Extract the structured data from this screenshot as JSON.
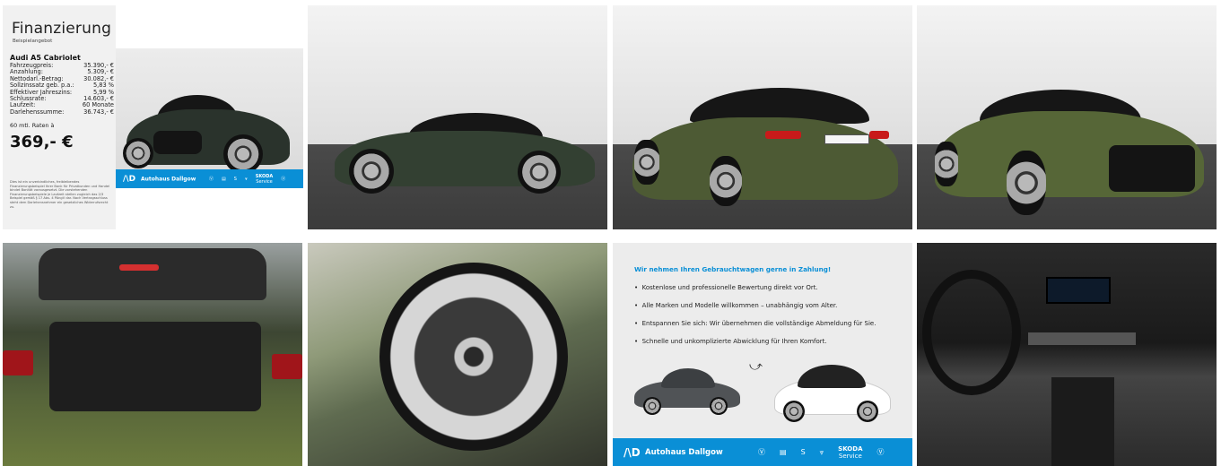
{
  "financing": {
    "title": "Finanzierung",
    "subtitle": "Beispielangebot",
    "model": "Audi A5 Cabriolet",
    "rows": [
      {
        "label": "Fahrzeugpreis:",
        "value": "35.390,- €"
      },
      {
        "label": "Anzahlung:",
        "value": "5.309,- €"
      },
      {
        "label": "Nettodarl.-Betrag:",
        "value": "30.082,- €"
      },
      {
        "label": "Sollzinssatz geb. p.a.:",
        "value": "5,83 %"
      },
      {
        "label": "Effektiver Jahreszins:",
        "value": "5,99 %"
      },
      {
        "label": "Schlussrate:",
        "value": "14.603,- €"
      },
      {
        "label": "Laufzeit:",
        "value": "60 Monate"
      },
      {
        "label": "Darlehenssumme:",
        "value": "36.743,- €"
      }
    ],
    "rate_label": "60 mtl. Raten à",
    "rate_value": "369,- €",
    "footnote": "Dies ist ein unverbindliches, freibleibendes Finanzierungsbeispiel Ihrer Bank für Privatkunden und Handel bindet Bonität vorausgesetzt. Die vorstehenden Finanzierungsbeispiele je Laufzeit stellen zugleich das 2/3 Beispiel gemäß § 17 Abs. 4 PAngV dar. Nach Vertragsschluss steht dem Darlehensnehmer ein gesetzliches Widerrufsrecht zu."
  },
  "dealer": {
    "name": "Autohaus Dallgow",
    "brands": [
      "VW",
      "Nutzfahrzeuge",
      "SEAT",
      "CUPRA",
      "SKODA Service",
      "VW Nutzfahrzeuge"
    ],
    "skoda_label": "SKODA",
    "service_label": "Service"
  },
  "trade_in": {
    "headline": "Wir nehmen Ihren Gebrauchtwagen gerne in Zahlung!",
    "items": [
      "Kostenlose und professionelle Bewertung direkt vor Ort.",
      "Alle Marken und Modelle willkommen – unabhängig vom Alter.",
      "Entspannen Sie sich: Wir übernehmen die vollständige Abmeldung für Sie.",
      "Schnelle und unkomplizierte Abwicklung für Ihren Komfort."
    ]
  },
  "colors": {
    "dealer_blue": "#0a8fd6",
    "car_green": "#55643a",
    "roof_black": "#161616"
  }
}
